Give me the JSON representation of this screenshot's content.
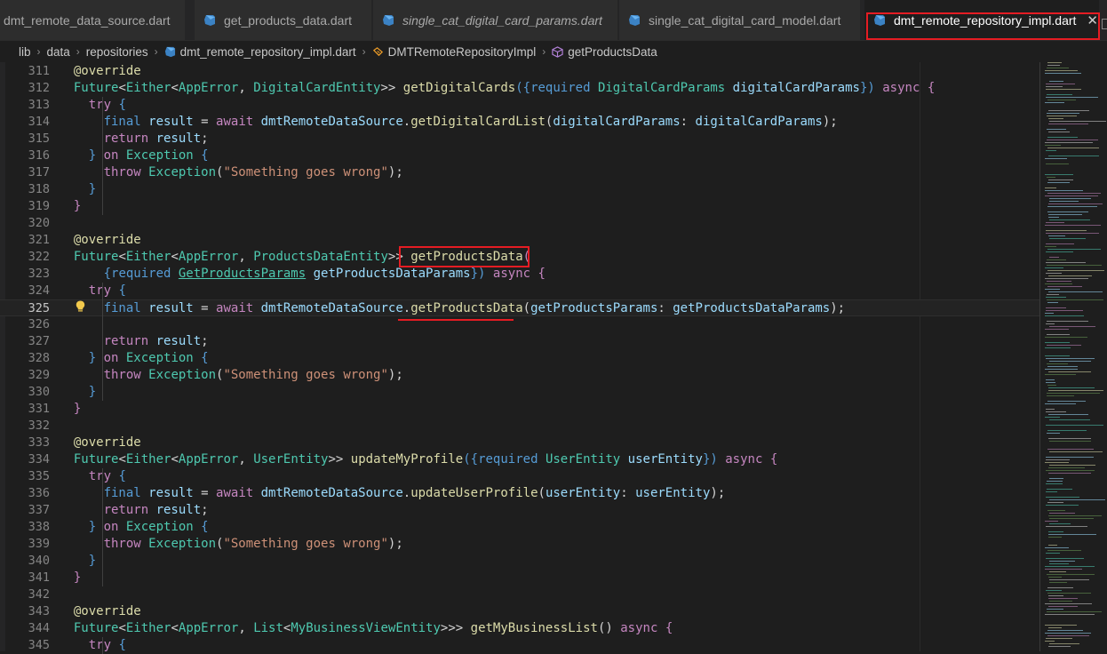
{
  "tabs": [
    {
      "label": "dmt_remote_data_source.dart",
      "italic": false,
      "active": false,
      "icon": "dart-icon"
    },
    {
      "label": "get_products_data.dart",
      "italic": false,
      "active": false,
      "icon": "dart-icon"
    },
    {
      "label": "single_cat_digital_card_params.dart",
      "italic": true,
      "active": false,
      "icon": "dart-icon"
    },
    {
      "label": "single_cat_digital_card_model.dart",
      "italic": false,
      "active": false,
      "icon": "dart-icon"
    },
    {
      "label": "dmt_remote_repository_impl.dart",
      "italic": false,
      "active": true,
      "icon": "dart-icon",
      "close": "✕"
    }
  ],
  "breadcrumb": {
    "items": [
      "lib",
      "data",
      "repositories",
      "dmt_remote_repository_impl.dart",
      "DMTRemoteRepositoryImpl",
      "getProductsData"
    ],
    "separator": "›"
  },
  "editor": {
    "current_line": 325,
    "highlight_color": "#e51c23",
    "lines": [
      {
        "n": "311",
        "tokens": [
          [
            "  @override",
            "dec"
          ]
        ]
      },
      {
        "n": "312",
        "tokens": [
          [
            "  Future",
            "ty"
          ],
          [
            "<",
            "op"
          ],
          [
            "Either",
            "ty"
          ],
          [
            "<",
            "op"
          ],
          [
            "AppError",
            "ty"
          ],
          [
            ", ",
            "op"
          ],
          [
            "DigitalCardEntity",
            "ty"
          ],
          [
            ">> ",
            "op"
          ],
          [
            "getDigitalCards",
            "fn"
          ],
          [
            "({",
            "kw2"
          ],
          [
            "required ",
            "kw2"
          ],
          [
            "DigitalCardParams ",
            "ty"
          ],
          [
            "digitalCardParams",
            "var"
          ],
          [
            "}) ",
            "kw2"
          ],
          [
            "async ",
            "kw"
          ],
          [
            "{",
            "kw"
          ]
        ]
      },
      {
        "n": "313",
        "tokens": [
          [
            "    try ",
            "kw"
          ],
          [
            "{",
            "kw2"
          ]
        ]
      },
      {
        "n": "314",
        "tokens": [
          [
            "      final ",
            "kw2"
          ],
          [
            "result ",
            "var"
          ],
          [
            "= ",
            "op"
          ],
          [
            "await ",
            "kw"
          ],
          [
            "dmtRemoteDataSource",
            "var"
          ],
          [
            ".",
            "op"
          ],
          [
            "getDigitalCardList",
            "fn"
          ],
          [
            "(",
            "op"
          ],
          [
            "digitalCardParams",
            "var"
          ],
          [
            ": ",
            "op"
          ],
          [
            "digitalCardParams",
            "var"
          ],
          [
            ");",
            "op"
          ]
        ]
      },
      {
        "n": "315",
        "tokens": [
          [
            "      return ",
            "kw"
          ],
          [
            "result",
            "var"
          ],
          [
            ";",
            "op"
          ]
        ]
      },
      {
        "n": "316",
        "tokens": [
          [
            "    } ",
            "kw2"
          ],
          [
            "on ",
            "kw"
          ],
          [
            "Exception ",
            "ty"
          ],
          [
            "{",
            "kw2"
          ]
        ]
      },
      {
        "n": "317",
        "tokens": [
          [
            "      throw ",
            "kw"
          ],
          [
            "Exception",
            "ty"
          ],
          [
            "(",
            "op"
          ],
          [
            "\"Something goes wrong\"",
            "str"
          ],
          [
            ");",
            "op"
          ]
        ]
      },
      {
        "n": "318",
        "tokens": [
          [
            "    }",
            "kw2"
          ]
        ]
      },
      {
        "n": "319",
        "tokens": [
          [
            "  }",
            "kw"
          ]
        ]
      },
      {
        "n": "320",
        "tokens": []
      },
      {
        "n": "321",
        "tokens": [
          [
            "  @override",
            "dec"
          ]
        ]
      },
      {
        "n": "322",
        "tokens": [
          [
            "  Future",
            "ty"
          ],
          [
            "<",
            "op"
          ],
          [
            "Either",
            "ty"
          ],
          [
            "<",
            "op"
          ],
          [
            "AppError",
            "ty"
          ],
          [
            ", ",
            "op"
          ],
          [
            "ProductsDataEntity",
            "ty"
          ],
          [
            ">> ",
            "op"
          ],
          [
            "getProductsData",
            "fn"
          ],
          [
            "(",
            "kw"
          ]
        ]
      },
      {
        "n": "323",
        "tokens": [
          [
            "      {",
            "kw2"
          ],
          [
            "required ",
            "kw2"
          ],
          [
            "GetProductsParams",
            "link"
          ],
          [
            " ",
            "op"
          ],
          [
            "getProductsDataParams",
            "var"
          ],
          [
            "}) ",
            "kw2"
          ],
          [
            "async ",
            "kw"
          ],
          [
            "{",
            "kw"
          ]
        ]
      },
      {
        "n": "324",
        "tokens": [
          [
            "    try ",
            "kw"
          ],
          [
            "{",
            "kw2"
          ]
        ]
      },
      {
        "n": "325",
        "tokens": [
          [
            "      final ",
            "kw2"
          ],
          [
            "result ",
            "var"
          ],
          [
            "= ",
            "op"
          ],
          [
            "await ",
            "kw"
          ],
          [
            "dmtRemoteDataSource",
            "var"
          ],
          [
            ".",
            "op"
          ],
          [
            "getProductsData",
            "fn"
          ],
          [
            "(",
            "op"
          ],
          [
            "getProductsParams",
            "var"
          ],
          [
            ": ",
            "op"
          ],
          [
            "getProductsDataParams",
            "var"
          ],
          [
            ");",
            "op"
          ]
        ]
      },
      {
        "n": "326",
        "tokens": []
      },
      {
        "n": "327",
        "tokens": [
          [
            "      return ",
            "kw"
          ],
          [
            "result",
            "var"
          ],
          [
            ";",
            "op"
          ]
        ]
      },
      {
        "n": "328",
        "tokens": [
          [
            "    } ",
            "kw2"
          ],
          [
            "on ",
            "kw"
          ],
          [
            "Exception ",
            "ty"
          ],
          [
            "{",
            "kw2"
          ]
        ]
      },
      {
        "n": "329",
        "tokens": [
          [
            "      throw ",
            "kw"
          ],
          [
            "Exception",
            "ty"
          ],
          [
            "(",
            "op"
          ],
          [
            "\"Something goes wrong\"",
            "str"
          ],
          [
            ");",
            "op"
          ]
        ]
      },
      {
        "n": "330",
        "tokens": [
          [
            "    }",
            "kw2"
          ]
        ]
      },
      {
        "n": "331",
        "tokens": [
          [
            "  }",
            "kw"
          ]
        ]
      },
      {
        "n": "332",
        "tokens": []
      },
      {
        "n": "333",
        "tokens": [
          [
            "  @override",
            "dec"
          ]
        ]
      },
      {
        "n": "334",
        "tokens": [
          [
            "  Future",
            "ty"
          ],
          [
            "<",
            "op"
          ],
          [
            "Either",
            "ty"
          ],
          [
            "<",
            "op"
          ],
          [
            "AppError",
            "ty"
          ],
          [
            ", ",
            "op"
          ],
          [
            "UserEntity",
            "ty"
          ],
          [
            ">> ",
            "op"
          ],
          [
            "updateMyProfile",
            "fn"
          ],
          [
            "({",
            "kw2"
          ],
          [
            "required ",
            "kw2"
          ],
          [
            "UserEntity ",
            "ty"
          ],
          [
            "userEntity",
            "var"
          ],
          [
            "}) ",
            "kw2"
          ],
          [
            "async ",
            "kw"
          ],
          [
            "{",
            "kw"
          ]
        ]
      },
      {
        "n": "335",
        "tokens": [
          [
            "    try ",
            "kw"
          ],
          [
            "{",
            "kw2"
          ]
        ]
      },
      {
        "n": "336",
        "tokens": [
          [
            "      final ",
            "kw2"
          ],
          [
            "result ",
            "var"
          ],
          [
            "= ",
            "op"
          ],
          [
            "await ",
            "kw"
          ],
          [
            "dmtRemoteDataSource",
            "var"
          ],
          [
            ".",
            "op"
          ],
          [
            "updateUserProfile",
            "fn"
          ],
          [
            "(",
            "op"
          ],
          [
            "userEntity",
            "var"
          ],
          [
            ": ",
            "op"
          ],
          [
            "userEntity",
            "var"
          ],
          [
            ");",
            "op"
          ]
        ]
      },
      {
        "n": "337",
        "tokens": [
          [
            "      return ",
            "kw"
          ],
          [
            "result",
            "var"
          ],
          [
            ";",
            "op"
          ]
        ]
      },
      {
        "n": "338",
        "tokens": [
          [
            "    } ",
            "kw2"
          ],
          [
            "on ",
            "kw"
          ],
          [
            "Exception ",
            "ty"
          ],
          [
            "{",
            "kw2"
          ]
        ]
      },
      {
        "n": "339",
        "tokens": [
          [
            "      throw ",
            "kw"
          ],
          [
            "Exception",
            "ty"
          ],
          [
            "(",
            "op"
          ],
          [
            "\"Something goes wrong\"",
            "str"
          ],
          [
            ");",
            "op"
          ]
        ]
      },
      {
        "n": "340",
        "tokens": [
          [
            "    }",
            "kw2"
          ]
        ]
      },
      {
        "n": "341",
        "tokens": [
          [
            "  }",
            "kw"
          ]
        ]
      },
      {
        "n": "342",
        "tokens": []
      },
      {
        "n": "343",
        "tokens": [
          [
            "  @override",
            "dec"
          ]
        ]
      },
      {
        "n": "344",
        "tokens": [
          [
            "  Future",
            "ty"
          ],
          [
            "<",
            "op"
          ],
          [
            "Either",
            "ty"
          ],
          [
            "<",
            "op"
          ],
          [
            "AppError",
            "ty"
          ],
          [
            ", ",
            "op"
          ],
          [
            "List",
            "ty"
          ],
          [
            "<",
            "op"
          ],
          [
            "MyBusinessViewEntity",
            "ty"
          ],
          [
            ">>> ",
            "op"
          ],
          [
            "getMyBusinessList",
            "fn"
          ],
          [
            "() ",
            "op"
          ],
          [
            "async ",
            "kw"
          ],
          [
            "{",
            "kw"
          ]
        ]
      },
      {
        "n": "345",
        "tokens": [
          [
            "    try ",
            "kw"
          ],
          [
            "{",
            "kw2"
          ]
        ]
      }
    ]
  }
}
